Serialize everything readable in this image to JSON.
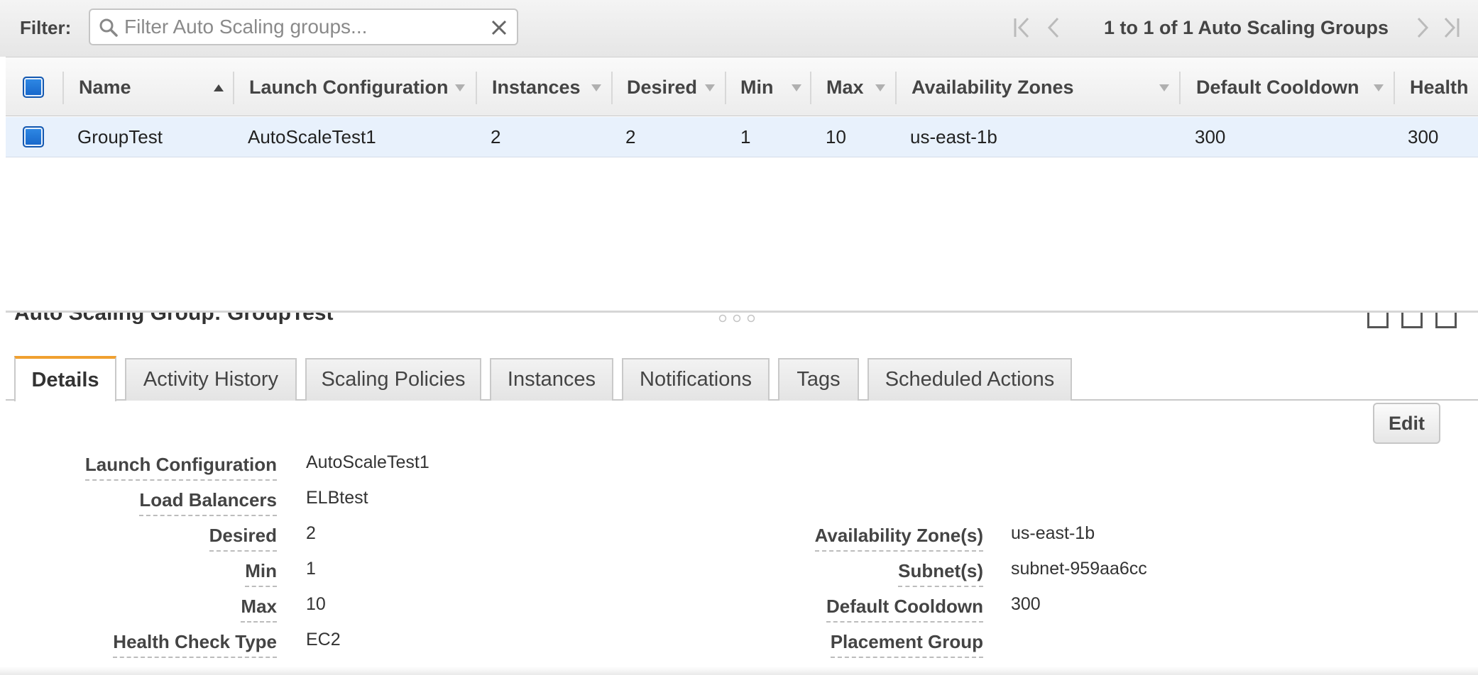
{
  "filter": {
    "label": "Filter:",
    "placeholder": "Filter Auto Scaling groups...",
    "value": ""
  },
  "pager": {
    "summary": "1 to 1 of 1 Auto Scaling Groups"
  },
  "table": {
    "columns": [
      "Name",
      "Launch Configuration",
      "Instances",
      "Desired",
      "Min",
      "Max",
      "Availability Zones",
      "Default Cooldown",
      "Health"
    ],
    "rows": [
      {
        "name": "GroupTest",
        "launch_configuration": "AutoScaleTest1",
        "instances": "2",
        "desired": "2",
        "min": "1",
        "max": "10",
        "availability_zones": "us-east-1b",
        "default_cooldown": "300",
        "health": "300",
        "selected": true
      }
    ]
  },
  "detail": {
    "title": "Auto Scaling Group: GroupTest",
    "tabs": [
      "Details",
      "Activity History",
      "Scaling Policies",
      "Instances",
      "Notifications",
      "Tags",
      "Scheduled Actions"
    ],
    "active_tab": "Details",
    "edit_label": "Edit",
    "left_fields": [
      {
        "label": "Launch Configuration",
        "value": "AutoScaleTest1"
      },
      {
        "label": "Load Balancers",
        "value": "ELBtest"
      },
      {
        "label": "Desired",
        "value": "2"
      },
      {
        "label": "Min",
        "value": "1"
      },
      {
        "label": "Max",
        "value": "10"
      },
      {
        "label": "Health Check Type",
        "value": "EC2"
      }
    ],
    "right_fields": [
      {
        "label": "Availability Zone(s)",
        "value": "us-east-1b"
      },
      {
        "label": "Subnet(s)",
        "value": "subnet-959aa6cc"
      },
      {
        "label": "Default Cooldown",
        "value": "300"
      },
      {
        "label": "Placement Group",
        "value": ""
      }
    ]
  },
  "colors": {
    "accent_tab": "#f0a030",
    "checkbox": "#1766c9",
    "selected_row": "#e8f1fc"
  }
}
